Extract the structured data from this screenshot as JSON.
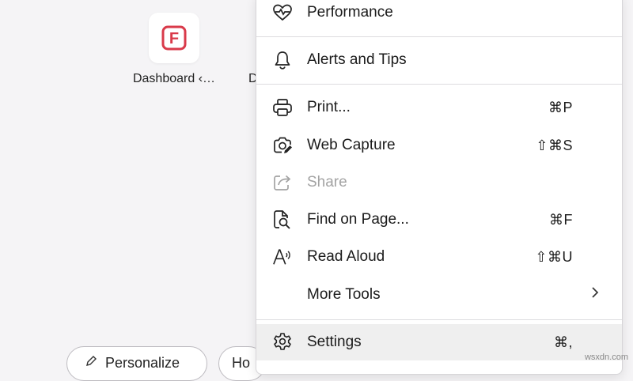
{
  "new_tab": {
    "tile": {
      "label": "Dashboard ‹…",
      "icon": "file-f-logo",
      "icon_glyph": "F",
      "brand_color": "#d93a4a"
    },
    "tile_2": {
      "label": "D"
    },
    "bottom_buttons": [
      {
        "label": "Personalize",
        "icon": "pencil-icon"
      },
      {
        "label": "Ho"
      }
    ]
  },
  "menu": {
    "items": [
      {
        "id": "performance",
        "label": "Performance",
        "icon": "heart-pulse-icon",
        "shortcut": ""
      },
      {
        "id": "alerts",
        "label": "Alerts and Tips",
        "icon": "bell-icon",
        "shortcut": ""
      },
      {
        "id": "print",
        "label": "Print...",
        "icon": "printer-icon",
        "shortcut": "⌘P"
      },
      {
        "id": "web-capture",
        "label": "Web Capture",
        "icon": "camera-icon",
        "shortcut": "⇧⌘S"
      },
      {
        "id": "share",
        "label": "Share",
        "icon": "share-icon",
        "shortcut": "",
        "disabled": true
      },
      {
        "id": "find",
        "label": "Find on Page...",
        "icon": "find-page-icon",
        "shortcut": "⌘F"
      },
      {
        "id": "read-aloud",
        "label": "Read Aloud",
        "icon": "read-aloud-icon",
        "shortcut": "⇧⌘U"
      },
      {
        "id": "more-tools",
        "label": "More Tools",
        "icon": "",
        "shortcut": "",
        "submenu": true
      },
      {
        "id": "settings",
        "label": "Settings",
        "icon": "gear-icon",
        "shortcut": "⌘,",
        "hovered": true
      }
    ]
  },
  "watermark": "wsxdn.com",
  "colors": {
    "cursor": "#c33ddb",
    "disabled_text": "#a3a3a3"
  }
}
